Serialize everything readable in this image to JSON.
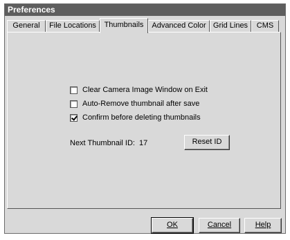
{
  "window": {
    "title": "Preferences"
  },
  "tabs": [
    {
      "label": "General"
    },
    {
      "label": "File Locations"
    },
    {
      "label": "Thumbnails"
    },
    {
      "label": "Advanced Color"
    },
    {
      "label": "Grid Lines"
    },
    {
      "label": "CMS"
    }
  ],
  "active_tab": "Thumbnails",
  "options": [
    {
      "label": "Clear Camera Image Window on Exit",
      "checked": false
    },
    {
      "label": "Auto-Remove thumbnail after save",
      "checked": false
    },
    {
      "label": "Confirm before deleting thumbnails",
      "checked": true
    }
  ],
  "next_id": {
    "label": "Next Thumbnail ID:",
    "value": "17"
  },
  "buttons": {
    "reset_id": "Reset ID",
    "ok": "OK",
    "cancel": "Cancel",
    "help": "Help"
  }
}
